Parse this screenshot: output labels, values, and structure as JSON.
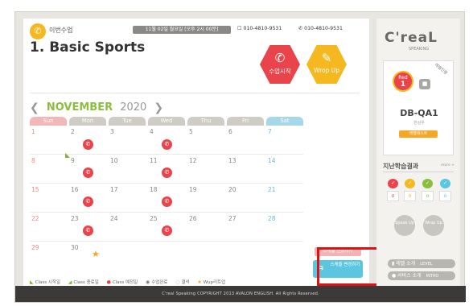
{
  "header": {
    "current_class_label": "이번수업",
    "datetime": "11월 02일 월요일 [오후 2시 00분]",
    "phone1": "010-4810-9531",
    "phone2": "010-4810-9531"
  },
  "lesson_title": "1. Basic Sports",
  "actions": {
    "start_label": "수업시작",
    "wrapup_label": "Wrop Up"
  },
  "calendar": {
    "month": "NOVEMBER",
    "year": "2020",
    "weekdays": [
      "Sun",
      "Mon",
      "Tue",
      "Wed",
      "Thu",
      "Fri",
      "Sat"
    ],
    "weeks": [
      [
        "1",
        "2",
        "3",
        "4",
        "5",
        "6",
        "7"
      ],
      [
        "8",
        "9",
        "10",
        "11",
        "12",
        "13",
        "14"
      ],
      [
        "15",
        "16",
        "17",
        "18",
        "19",
        "20",
        "21"
      ],
      [
        "22",
        "23",
        "24",
        "25",
        "26",
        "27",
        "28"
      ],
      [
        "29",
        "30",
        "",
        "",
        "",
        "",
        ""
      ]
    ]
  },
  "schedule": {
    "popup": "스케줄 변경하기",
    "change_button": "스케줄 변경하기"
  },
  "legend": [
    "Class 시작일",
    "Class 종료일",
    "Class 예정일",
    "수업완료",
    "결석",
    "Wup리트업"
  ],
  "footer": "C'real Speaking COPYRIGHT 2013 AVALON ENGLISH. All Rights Reserved.",
  "sidebar": {
    "logo": "C'reaL",
    "logo_sub": "SPEAKING",
    "ribbon": "레벨진행",
    "level_badge_top": "Red",
    "level_badge_num": "1",
    "course_code": "DB-QA1",
    "course_sub": "한상우",
    "course_btn": "레벨테스트",
    "results_title": "지난학습결과",
    "results_more": "more +",
    "result_marks": [
      "o",
      "o",
      "o",
      "o"
    ],
    "speak_up": "Speak Up",
    "wrap_up": "Wrap Up",
    "level_btn": "레벨 소개",
    "level_btn_en": "LEVEL",
    "service_btn": "서비스 소개",
    "service_btn_en": "INTRO"
  }
}
